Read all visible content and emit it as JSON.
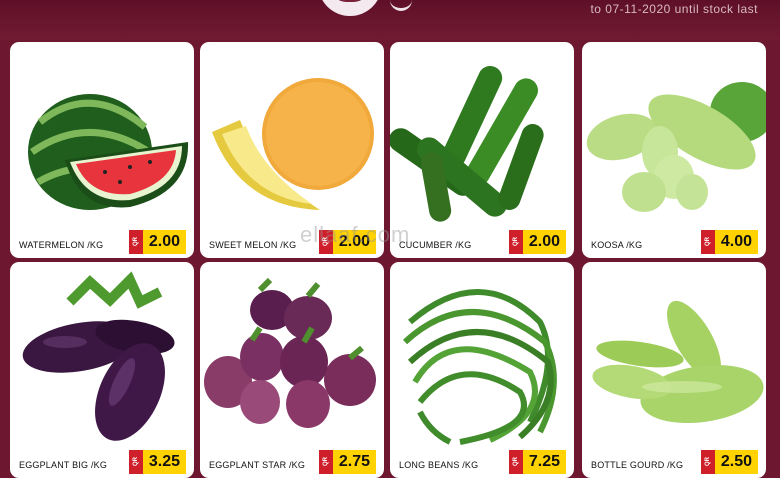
{
  "header": {
    "validity_text": "to 07-11-2020 until stock last"
  },
  "currency": "QR",
  "watermark": "ellaaf.com",
  "products": [
    {
      "name": "WATERMELON /KG",
      "price": "2.00"
    },
    {
      "name": "SWEET MELON /KG",
      "price": "2.00"
    },
    {
      "name": "CUCUMBER /KG",
      "price": "2.00"
    },
    {
      "name": "KOOSA /KG",
      "price": "4.00"
    },
    {
      "name": "EGGPLANT BIG /KG",
      "price": "3.25"
    },
    {
      "name": "EGGPLANT STAR /KG",
      "price": "2.75"
    },
    {
      "name": "LONG BEANS /KG",
      "price": "7.25"
    },
    {
      "name": "BOTTLE GOURD /KG",
      "price": "2.50"
    }
  ]
}
